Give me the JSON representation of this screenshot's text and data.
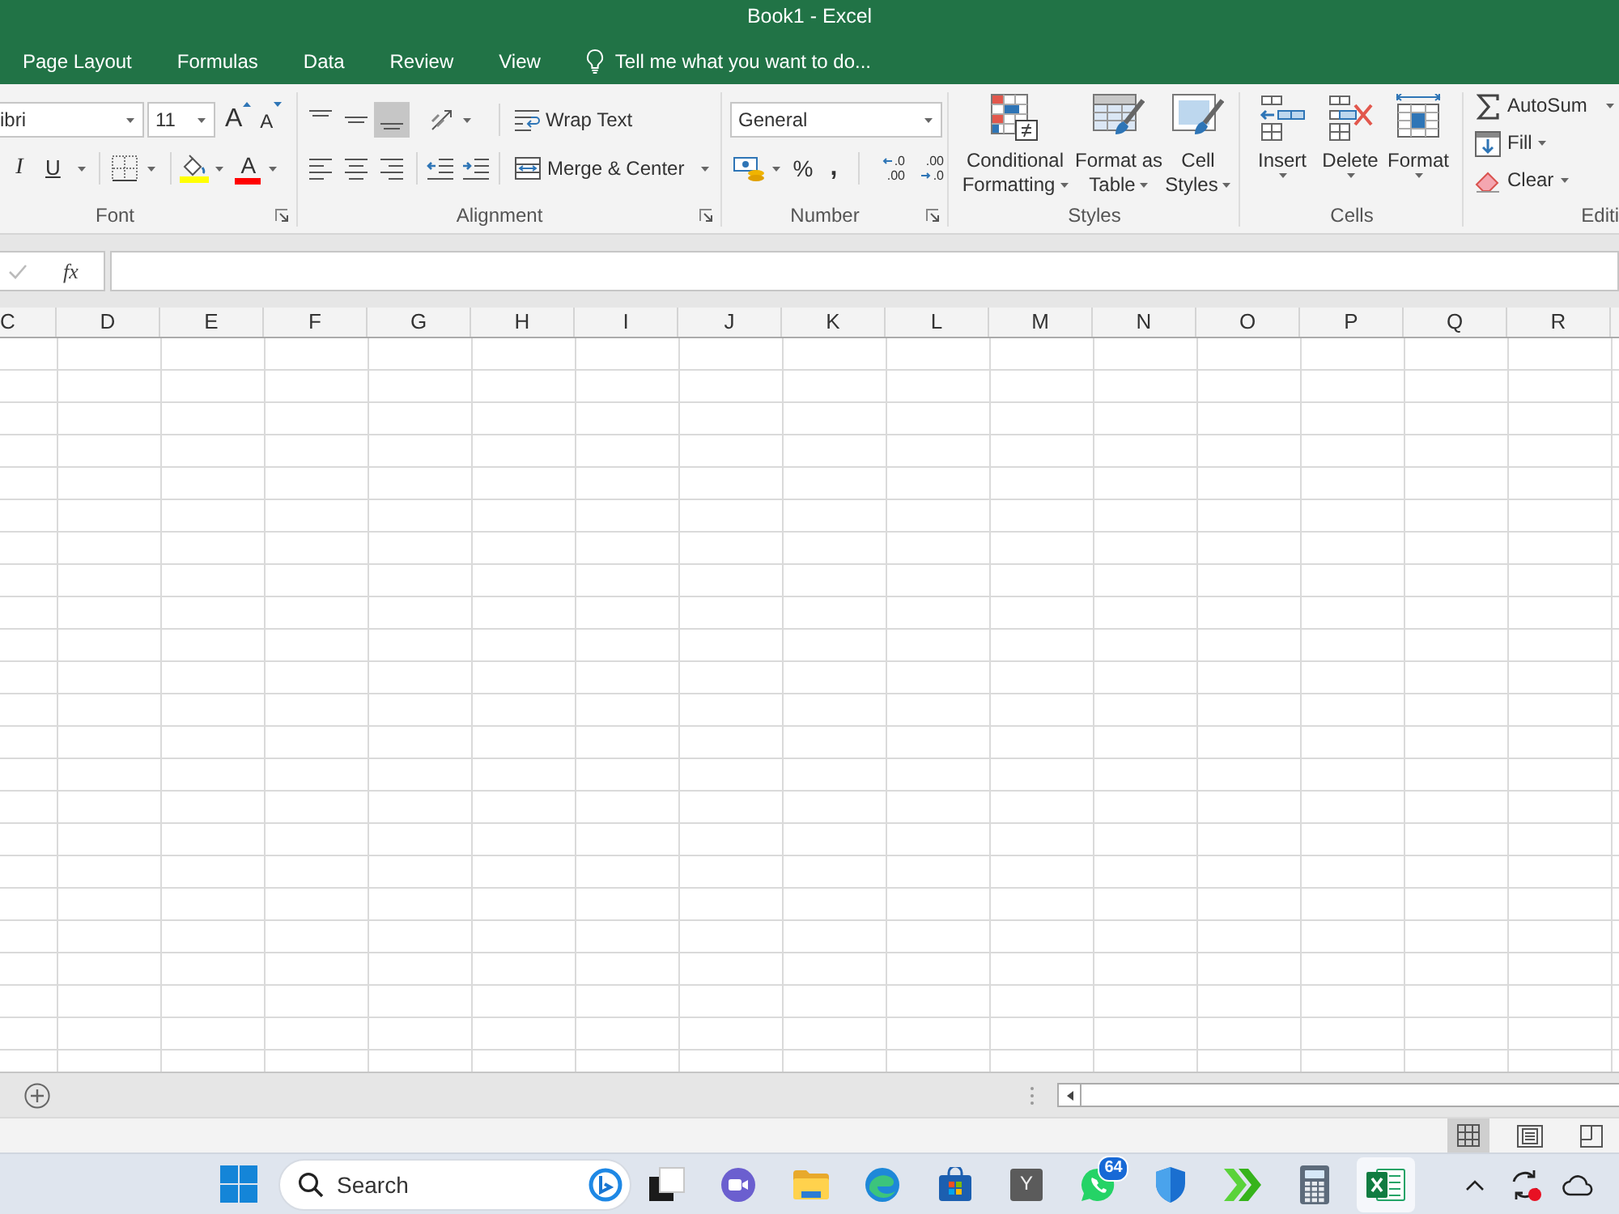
{
  "window": {
    "title": "Book1 - Excel"
  },
  "tabs": [
    {
      "label": "Page Layout",
      "selected": false
    },
    {
      "label": "Formulas",
      "selected": false
    },
    {
      "label": "Data",
      "selected": false
    },
    {
      "label": "Review",
      "selected": false
    },
    {
      "label": "View",
      "selected": false
    }
  ],
  "tell_me": {
    "placeholder": "Tell me what you want to do..."
  },
  "ribbon": {
    "font": {
      "label": "Font",
      "font_name": "ibri",
      "font_size": "11",
      "grow": "A",
      "shrink": "A",
      "italic": "I",
      "underline": "U",
      "font_color": "A"
    },
    "alignment": {
      "label": "Alignment",
      "vertical": [
        {
          "kind": "top",
          "selected": false
        },
        {
          "kind": "middle",
          "selected": false
        },
        {
          "kind": "bottom",
          "selected": true
        }
      ],
      "wrap_text": "Wrap Text",
      "merge": "Merge & Center"
    },
    "number": {
      "label": "Number",
      "format": "General",
      "percent": "%",
      "comma": ",",
      "increase_decimal": [
        ".0",
        ".00"
      ],
      "decrease_decimal": [
        ".00",
        ".0"
      ]
    },
    "styles": {
      "label": "Styles",
      "buttons": [
        {
          "kind": "conditional",
          "lines": [
            "Conditional",
            "Formatting"
          ]
        },
        {
          "kind": "table",
          "lines": [
            "Format as",
            "Table"
          ]
        },
        {
          "kind": "cell_styles",
          "lines": [
            "Cell",
            "Styles"
          ]
        }
      ]
    },
    "cells": {
      "label": "Cells",
      "buttons": [
        {
          "kind": "insert",
          "label": "Insert"
        },
        {
          "kind": "delete",
          "label": "Delete"
        },
        {
          "kind": "format",
          "label": "Format"
        }
      ]
    },
    "editing": {
      "label": "Editi",
      "buttons": [
        {
          "kind": "autosum",
          "label": "AutoSum"
        },
        {
          "kind": "fill",
          "label": "Fill"
        },
        {
          "kind": "clear",
          "label": "Clear"
        }
      ]
    }
  },
  "formula_bar": {
    "function_label": "fx"
  },
  "columns": [
    "C",
    "D",
    "E",
    "F",
    "G",
    "H",
    "I",
    "J",
    "K",
    "L",
    "M",
    "N",
    "O",
    "P",
    "Q",
    "R"
  ],
  "views": [
    {
      "kind": "normal",
      "selected": true
    },
    {
      "kind": "page_layout",
      "selected": false
    },
    {
      "kind": "page_break",
      "selected": false
    }
  ],
  "taskbar": {
    "search": {
      "placeholder": "Search"
    },
    "apps": [
      {
        "kind": "stacked",
        "active": false
      },
      {
        "kind": "video",
        "active": false
      },
      {
        "kind": "folder",
        "active": false
      },
      {
        "kind": "browser",
        "active": false
      },
      {
        "kind": "store",
        "active": false
      },
      {
        "kind": "tile",
        "label": "Y",
        "active": false
      },
      {
        "kind": "chat",
        "badge": "64",
        "active": false
      },
      {
        "kind": "shield",
        "active": false
      },
      {
        "kind": "chevrons",
        "active": false
      },
      {
        "kind": "calculator",
        "active": false
      },
      {
        "kind": "spreadsheet",
        "active": true
      }
    ]
  }
}
